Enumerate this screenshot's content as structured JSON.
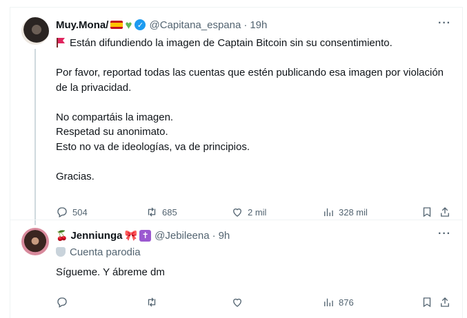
{
  "tweets": [
    {
      "name": "Muy.Mona/",
      "name_emojis": [
        "spain-flag",
        "green-heart"
      ],
      "handle": "@Capitana_espana",
      "time": "19h",
      "text": "Están difundiendo la imagen de Captain Bitcoin sin su consentimiento.\n\nPor favor, reportad todas las cuentas que estén publicando esa imagen por violación de la privacidad.\n\nNo compartáis la imagen.\nRespetad su anonimato.\nEsto no va de ideologías, va de principios.\n\nGracias.",
      "stats": {
        "replies": "504",
        "retweets": "685",
        "likes": "2 mil",
        "views": "328 mil"
      }
    },
    {
      "name": "Jenniunga",
      "name_emojis": [
        "cherries",
        "ribbon",
        "latin-cross"
      ],
      "handle": "@Jebileena",
      "time": "9h",
      "parody_label": "Cuenta parodia",
      "text": "Sígueme. Y ábreme dm",
      "stats": {
        "replies": "",
        "retweets": "",
        "likes": "",
        "views": "876"
      }
    }
  ],
  "separator": "·",
  "more_label": "···",
  "colors": {
    "verified": "#1d9bf0",
    "text": "#0f1419",
    "muted": "#536471",
    "border": "#eff3f4"
  }
}
